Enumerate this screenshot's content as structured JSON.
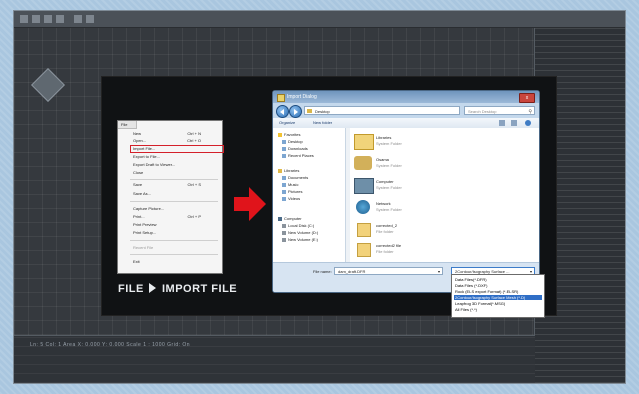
{
  "file_menu": {
    "title": "File",
    "items": [
      {
        "label": "New",
        "shortcut": "Ctrl + N"
      },
      {
        "label": "Open...",
        "shortcut": "Ctrl + O"
      },
      {
        "label": "Import File...",
        "shortcut": ""
      },
      {
        "label": "Export to File...",
        "shortcut": ""
      },
      {
        "label": "Export Draft to Viewer...",
        "shortcut": ""
      },
      {
        "label": "Close",
        "shortcut": ""
      },
      {
        "label": "Save",
        "shortcut": "Ctrl + S"
      },
      {
        "label": "Save As...",
        "shortcut": ""
      },
      {
        "label": "Capture Picture...",
        "shortcut": ""
      },
      {
        "label": "Print...",
        "shortcut": "Ctrl + P"
      },
      {
        "label": "Print Preview",
        "shortcut": ""
      },
      {
        "label": "Print Setup...",
        "shortcut": ""
      },
      {
        "label": "Recent File",
        "shortcut": ""
      },
      {
        "label": "Exit",
        "shortcut": ""
      }
    ]
  },
  "caption": {
    "left": "FILE",
    "right": "IMPORT FILE"
  },
  "dialog": {
    "title": "Import Dialog",
    "close_label": "x",
    "address": "Desktop",
    "search_placeholder": "Search Desktop",
    "organize_label": "Organize",
    "new_folder_label": "New folder",
    "nav_items": [
      "Favorites",
      "Desktop",
      "Downloads",
      "Recent Places",
      "Libraries",
      "Documents",
      "Music",
      "Pictures",
      "Videos",
      "Computer",
      "Local Disk (C:)",
      "New Volume (D:)",
      "New Volume (E:)"
    ],
    "files": [
      {
        "name": "Libraries",
        "sub": "System Folder",
        "icon": "library-icon"
      },
      {
        "name": "Osama",
        "sub": "System Folder",
        "icon": "user-folder-icon"
      },
      {
        "name": "Computer",
        "sub": "System Folder",
        "icon": "computer-icon"
      },
      {
        "name": "Network",
        "sub": "System Folder",
        "icon": "network-icon"
      },
      {
        "name": "corrected_2",
        "sub": "File folder",
        "icon": "folder-icon"
      },
      {
        "name": "corrected2 file",
        "sub": "File folder",
        "icon": "folder-icon"
      }
    ],
    "file_name_label": "File name:",
    "file_name_value": "dam_draft.DFR",
    "file_type_selected": "2Contour/Isography Surface ...",
    "file_type_options": [
      "Data Files(*.DFR)",
      "Data Files (*.DXF)",
      "Rock (ELS export Format) (*.ELSR)",
      "2Contour/Isography Surface Mesh (*.D)",
      "Leapfrog 3D Format(*.MSG)",
      "All Files (*.*)"
    ],
    "file_type_selected_index": 3
  },
  "status_text": "Ln: 5  Col: 1   Area  X: 0.000  Y: 0.000     Scale 1 : 1000     Grid: On"
}
